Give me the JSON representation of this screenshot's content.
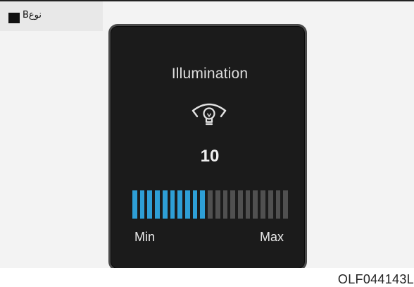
{
  "header": {
    "type_label": "نوعB"
  },
  "display": {
    "title": "Illumination",
    "icon": "illumination-bulb-icon",
    "value": "10",
    "level": {
      "current": 10,
      "max": 21,
      "active_color": "#2e9fd6",
      "inactive_color": "#505050"
    },
    "min_label": "Min",
    "max_label": "Max"
  },
  "figure": {
    "code": "OLF044143L"
  }
}
